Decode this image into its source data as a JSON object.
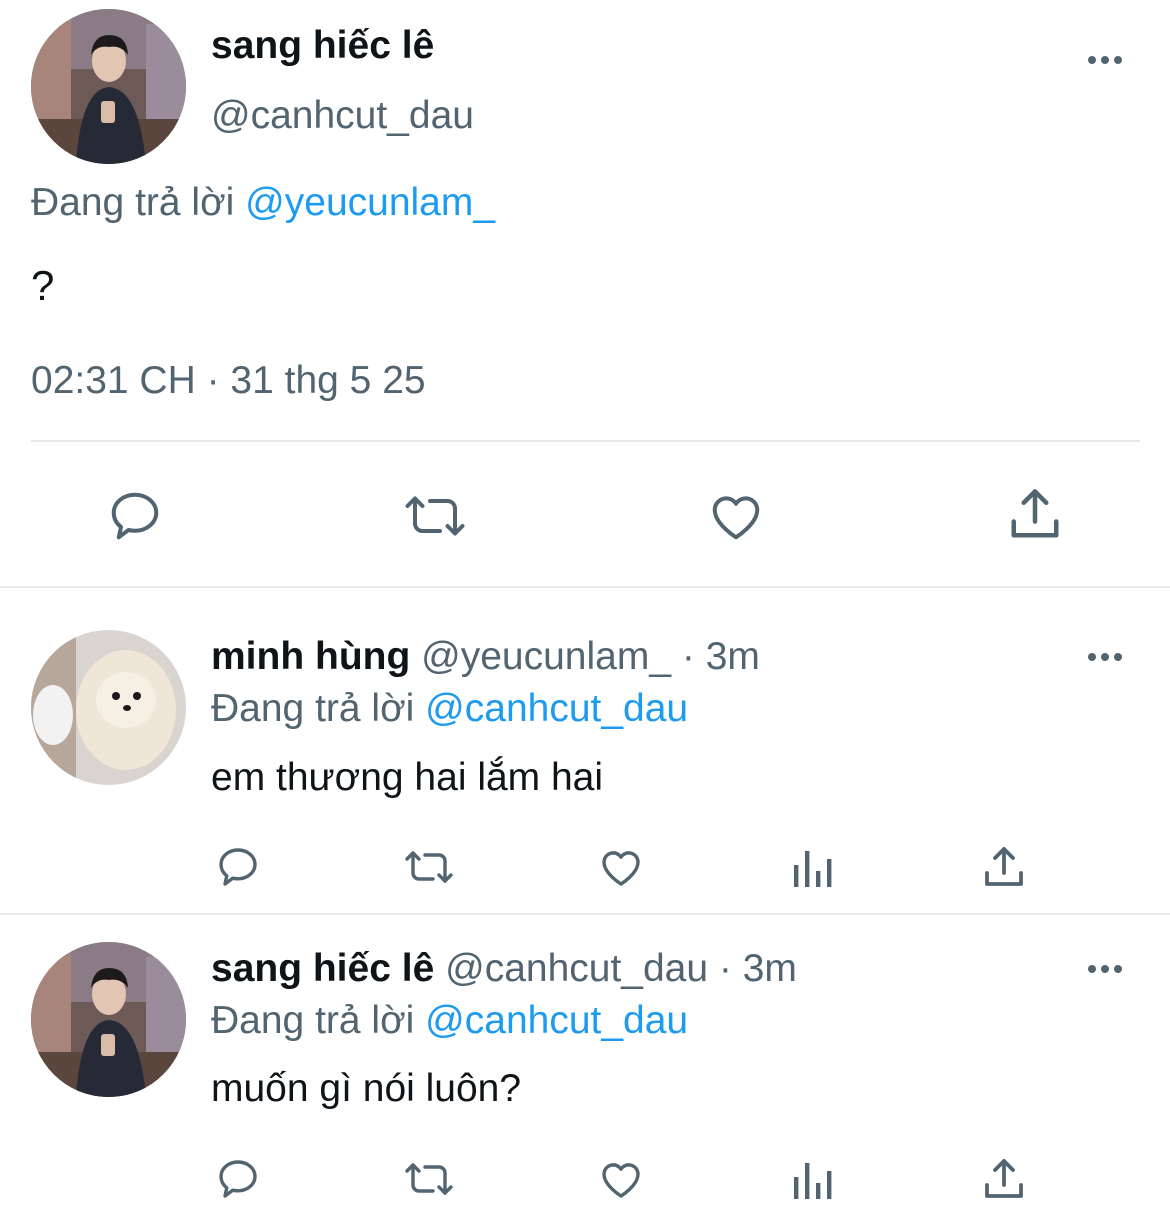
{
  "main_tweet": {
    "author_name": "sang hiếc lê",
    "handle": "@canhcut_dau",
    "replying_prefix": "Đang trả lời",
    "replying_to": "@yeucunlam_",
    "text": "?",
    "timestamp": "02:31 CH · 31 thg 5 25",
    "actions": [
      "reply-icon",
      "retweet-icon",
      "like-icon",
      "share-icon"
    ]
  },
  "replies": [
    {
      "author_name": "minh hùng",
      "handle": "@yeucunlam_",
      "time": "· 3m",
      "replying_prefix": "Đang trả lời",
      "replying_to": "@canhcut_dau",
      "text": "em thương hai lắm hai"
    },
    {
      "author_name": "sang hiếc lê",
      "handle": "@canhcut_dau",
      "time": "· 3m",
      "replying_prefix": "Đang trả lời",
      "replying_to": "@canhcut_dau",
      "text": "muốn gì nói luôn?"
    }
  ],
  "colors": {
    "accent": "#1d9bf0",
    "muted": "#536471",
    "text": "#0f1419",
    "divider": "#e7e9ea"
  }
}
